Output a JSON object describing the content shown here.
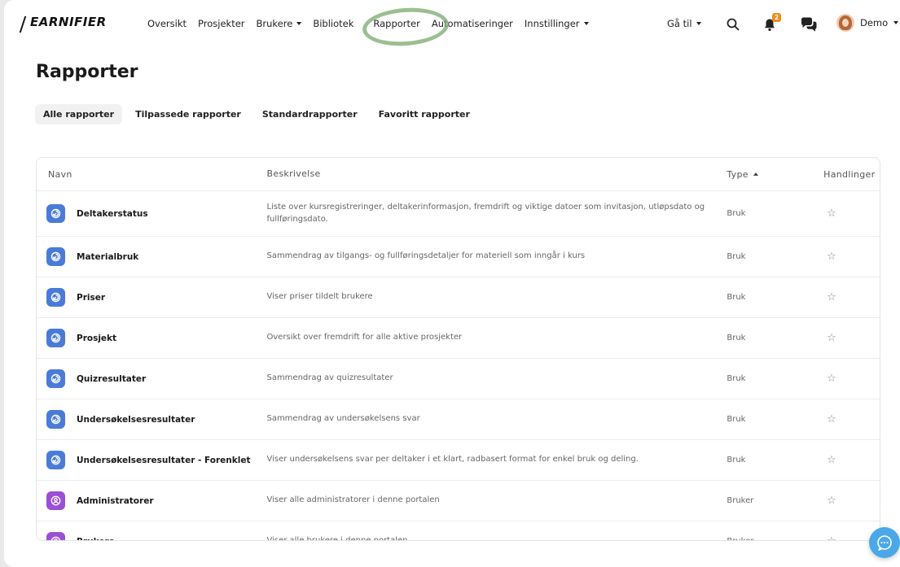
{
  "brand": {
    "logo_text": "EARNIFIER"
  },
  "nav": {
    "items": [
      {
        "label": "Oversikt",
        "has_caret": false
      },
      {
        "label": "Prosjekter",
        "has_caret": false
      },
      {
        "label": "Brukere",
        "has_caret": true
      },
      {
        "label": "Bibliotek",
        "has_caret": false
      },
      {
        "label": "Rapporter",
        "has_caret": false
      },
      {
        "label": "Automatiseringer",
        "has_caret": false
      },
      {
        "label": "Innstillinger",
        "has_caret": true
      }
    ],
    "goto_label": "Gå til",
    "notification_count": "2",
    "user_name": "Demo"
  },
  "page": {
    "title": "Rapporter"
  },
  "tabs": [
    {
      "label": "Alle rapporter",
      "active": true
    },
    {
      "label": "Tilpassede rapporter",
      "active": false
    },
    {
      "label": "Standardrapporter",
      "active": false
    },
    {
      "label": "Favoritt rapporter",
      "active": false
    }
  ],
  "table": {
    "headers": {
      "name": "Navn",
      "description": "Beskrivelse",
      "type": "Type",
      "actions": "Handlinger"
    },
    "rows": [
      {
        "name": "Deltakerstatus",
        "description": "Liste over kursregistreringer, deltakerinformasjon, fremdrift og viktige datoer som invitasjon, utløpsdato og fullføringsdato.",
        "type": "Bruk",
        "icon": "usage-icon",
        "color": "#4b7bd8"
      },
      {
        "name": "Materialbruk",
        "description": "Sammendrag av tilgangs- og fullføringsdetaljer for materiell som inngår i kurs",
        "type": "Bruk",
        "icon": "usage-icon",
        "color": "#4b7bd8"
      },
      {
        "name": "Priser",
        "description": "Viser priser tildelt brukere",
        "type": "Bruk",
        "icon": "usage-icon",
        "color": "#4b7bd8"
      },
      {
        "name": "Prosjekt",
        "description": "Oversikt over fremdrift for alle aktive prosjekter",
        "type": "Bruk",
        "icon": "usage-icon",
        "color": "#4b7bd8"
      },
      {
        "name": "Quizresultater",
        "description": "Sammendrag av quizresultater",
        "type": "Bruk",
        "icon": "usage-icon",
        "color": "#4b7bd8"
      },
      {
        "name": "Undersøkelsesresultater",
        "description": "Sammendrag av undersøkelsens svar",
        "type": "Bruk",
        "icon": "usage-icon",
        "color": "#4b7bd8"
      },
      {
        "name": "Undersøkelsesresultater - Forenklet",
        "description": "Viser undersøkelsens svar per deltaker i et klart, radbasert format for enkel bruk og deling.",
        "type": "Bruk",
        "icon": "usage-icon",
        "color": "#4b7bd8"
      },
      {
        "name": "Administratorer",
        "description": "Viser alle administratorer i denne portalen",
        "type": "Bruker",
        "icon": "user-icon",
        "color": "#9b4fd6"
      },
      {
        "name": "Brukere",
        "description": "Viser alle brukere i denne portalen",
        "type": "Bruker",
        "icon": "user-icon",
        "color": "#9b4fd6"
      }
    ]
  },
  "colors": {
    "accent_blue": "#4b7bd8",
    "accent_purple": "#9b4fd6",
    "badge_orange": "#f08c1c",
    "chat_blue": "#4aa8e8"
  }
}
